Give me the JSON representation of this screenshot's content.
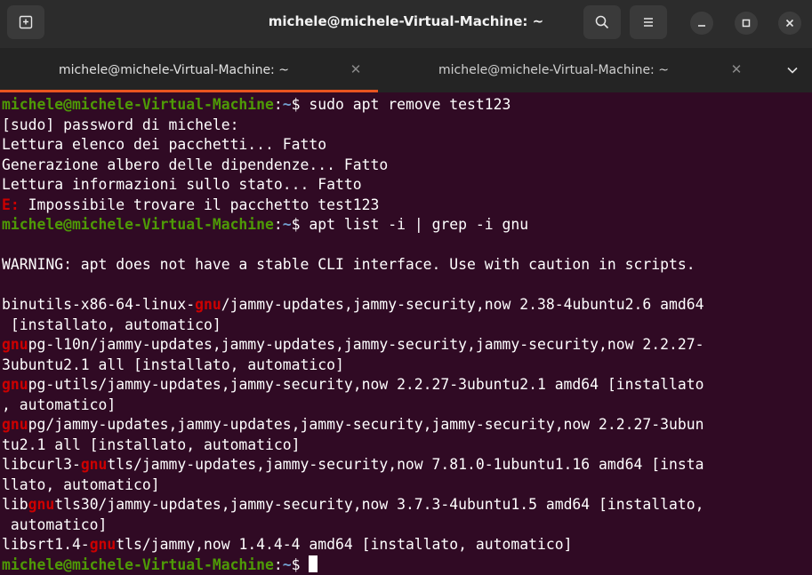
{
  "window": {
    "title": "michele@michele-Virtual-Machine: ~",
    "new_tab_icon": "new-tab-icon",
    "search_icon": "search-icon",
    "menu_icon": "hamburger-menu-icon",
    "minimize_icon": "minimize-icon",
    "maximize_icon": "maximize-icon",
    "close_icon": "close-icon"
  },
  "tabs": [
    {
      "label": "michele@michele-Virtual-Machine: ~",
      "active": true
    },
    {
      "label": "michele@michele-Virtual-Machine: ~",
      "active": false
    }
  ],
  "colors": {
    "terminal_bg": "#300a24",
    "prompt_user": "#4e9a06",
    "prompt_path": "#729fcf",
    "highlight": "#cc0000",
    "tab_accent": "#e95420"
  },
  "terminal": {
    "prompt_user": "michele@michele-Virtual-Machine",
    "prompt_path": "~",
    "prompt_symbol": "$",
    "cmd1": " sudo apt remove test123",
    "out_sudo": "[sudo] password di michele:",
    "out_lettura": "Lettura elenco dei pacchetti... Fatto",
    "out_generazione": "Generazione albero delle dipendenze... Fatto",
    "out_info": "Lettura informazioni sullo stato... Fatto",
    "err_prefix": "E:",
    "err_text": " Impossibile trovare il pacchetto test123",
    "cmd2": " apt list -i | grep -i gnu",
    "warning": "WARNING: apt does not have a stable CLI interface. Use with caution in scripts.",
    "match": "gnu",
    "r1a_pre": "binutils-x86-64-linux-",
    "r1a_post": "/jammy-updates,jammy-security,now 2.38-4ubuntu2.6 amd64",
    "r1b": " [installato, automatico]",
    "r2a_post": "pg-l10n/jammy-updates,jammy-updates,jammy-security,jammy-security,now 2.2.27-",
    "r2b": "3ubuntu2.1 all [installato, automatico]",
    "r3a_post": "pg-utils/jammy-updates,jammy-security,now 2.2.27-3ubuntu2.1 amd64 [installato",
    "r3b": ", automatico]",
    "r4a_post": "pg/jammy-updates,jammy-updates,jammy-security,jammy-security,now 2.2.27-3ubun",
    "r4b": "tu2.1 all [installato, automatico]",
    "r5a_pre": "libcurl3-",
    "r5a_post": "tls/jammy-updates,jammy-security,now 7.81.0-1ubuntu1.16 amd64 [insta",
    "r5b": "llato, automatico]",
    "r6a_pre": "lib",
    "r6a_post": "tls30/jammy-updates,jammy-security,now 3.7.3-4ubuntu1.5 amd64 [installato,",
    "r6b": " automatico]",
    "r7_pre": "libsrt1.4-",
    "r7_post": "tls/jammy,now 1.4.4-4 amd64 [installato, automatico]"
  }
}
